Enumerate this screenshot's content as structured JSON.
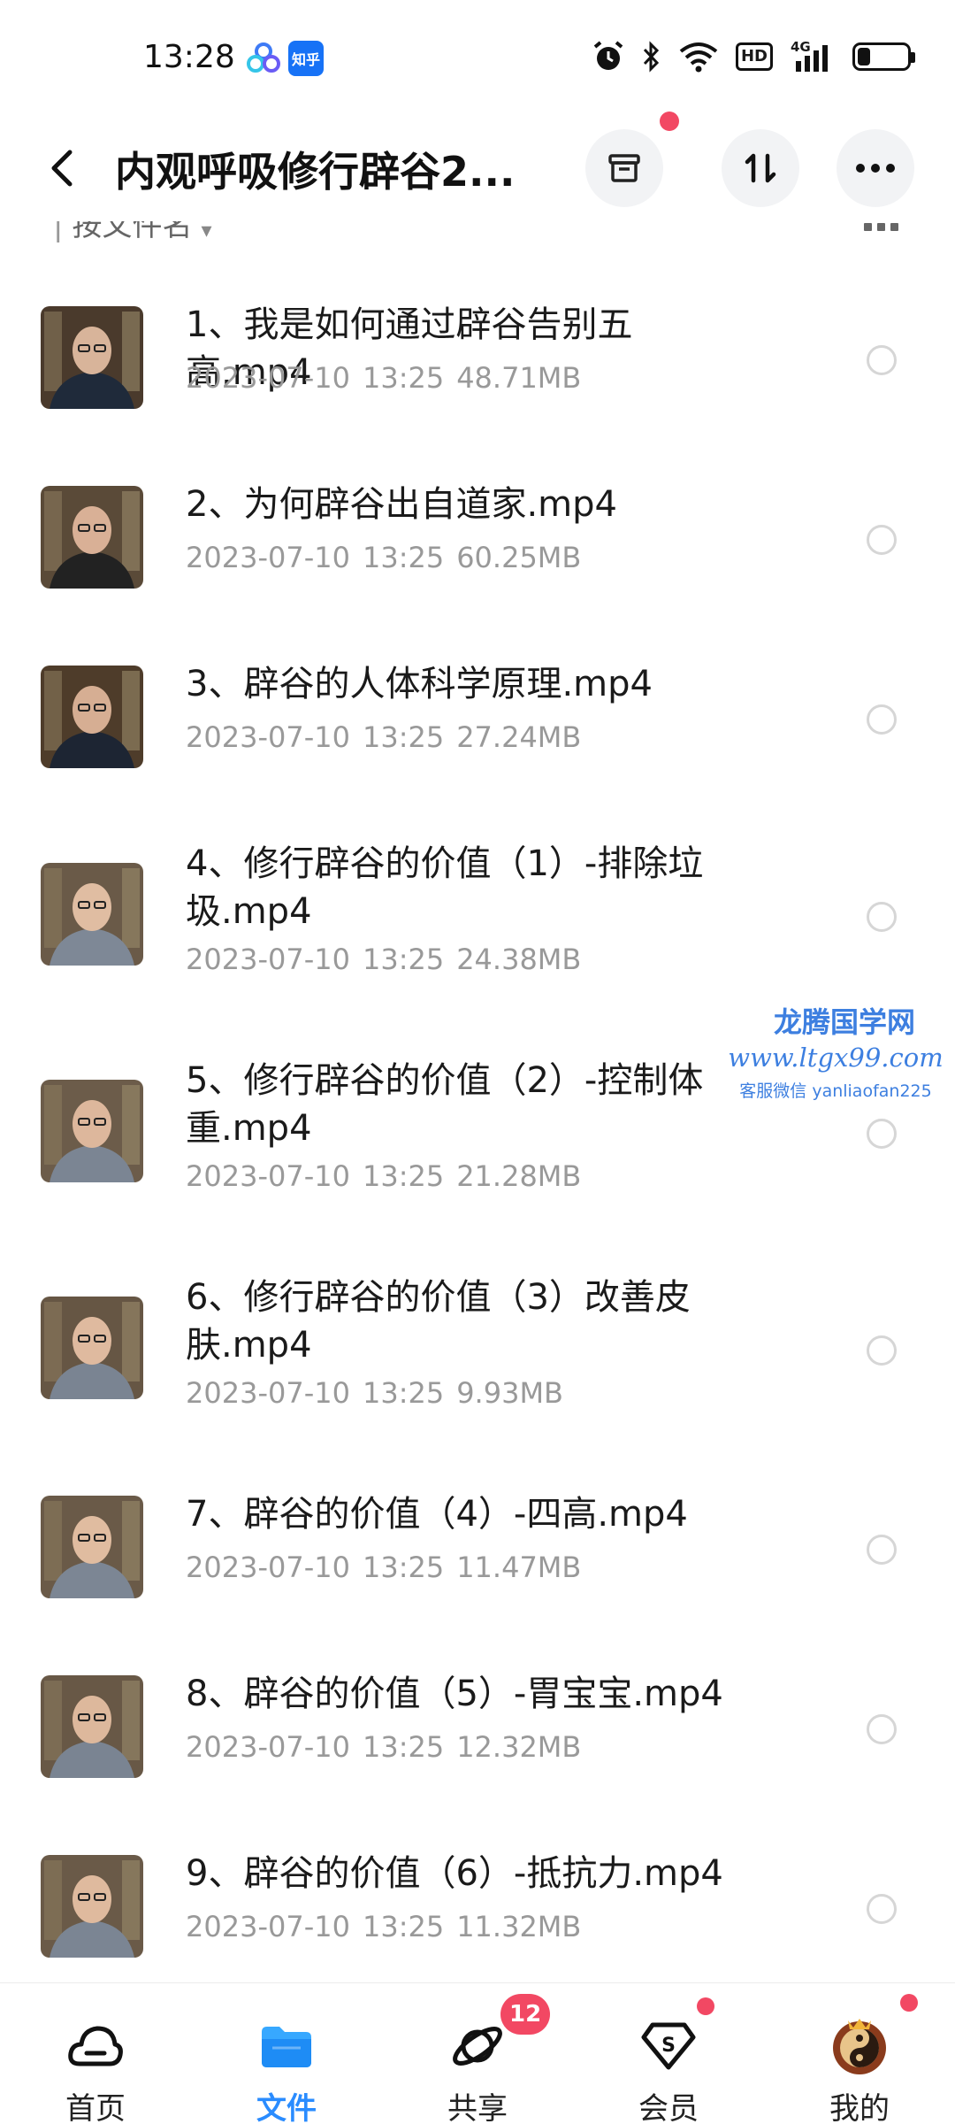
{
  "status_bar": {
    "time": "13:28",
    "app_icons": [
      "baidu-netdisk-icon",
      "zhihu-icon"
    ],
    "zhihu_label": "知乎",
    "right_icons": [
      "alarm-icon",
      "bluetooth-icon",
      "wifi-icon",
      "hd-icon",
      "4g-signal-icon",
      "battery-icon"
    ],
    "hd_label": "HD",
    "network_label": "4G",
    "battery_level": 0.25
  },
  "header": {
    "back_icon": "chevron-left-icon",
    "title": "内观呼吸修行辟谷2...",
    "archive_icon": "archive-icon",
    "sort_icon": "sort-arrows-icon",
    "more_icon": "more-horizontal-icon"
  },
  "sort_bar": {
    "label": "按文件名",
    "caret_icon": "caret-down-icon",
    "view_icon": "grid-view-icon"
  },
  "files": [
    {
      "name": "1、我是如何通过辟谷告别五高.mp4",
      "date": "2023-07-10",
      "time": "13:25",
      "size": "48.71MB"
    },
    {
      "name": "2、为何辟谷出自道家.mp4",
      "date": "2023-07-10",
      "time": "13:25",
      "size": "60.25MB"
    },
    {
      "name": "3、辟谷的人体科学原理.mp4",
      "date": "2023-07-10",
      "time": "13:25",
      "size": "27.24MB"
    },
    {
      "name": "4、修行辟谷的价值（1）-排除垃圾.mp4",
      "date": "2023-07-10",
      "time": "13:25",
      "size": "24.38MB"
    },
    {
      "name": "5、修行辟谷的价值（2）-控制体重.mp4",
      "date": "2023-07-10",
      "time": "13:25",
      "size": "21.28MB"
    },
    {
      "name": "6、修行辟谷的价值（3）改善皮肤.mp4",
      "date": "2023-07-10",
      "time": "13:25",
      "size": "9.93MB"
    },
    {
      "name": "7、辟谷的价值（4）-四高.mp4",
      "date": "2023-07-10",
      "time": "13:25",
      "size": "11.47MB"
    },
    {
      "name": "8、辟谷的价值（5）-胃宝宝.mp4",
      "date": "2023-07-10",
      "time": "13:25",
      "size": "12.32MB"
    },
    {
      "name": "9、辟谷的价值（6）-抵抗力.mp4",
      "date": "2023-07-10",
      "time": "13:25",
      "size": "11.32MB"
    }
  ],
  "watermark": {
    "line1": "龙腾国学网",
    "line2": "www.ltgx99.com",
    "line3": "客服微信 yanliaofan225"
  },
  "bottom_nav": {
    "items": [
      {
        "label": "首页",
        "icon": "home-cloud-icon"
      },
      {
        "label": "文件",
        "icon": "folder-icon"
      },
      {
        "label": "共享",
        "icon": "share-orbit-icon",
        "badge": "12"
      },
      {
        "label": "会员",
        "icon": "vip-diamond-icon"
      },
      {
        "label": "我的",
        "icon": "avatar-icon"
      }
    ]
  },
  "colors": {
    "accent": "#2a8cff",
    "badge": "#f24863",
    "meta_text": "#999999",
    "watermark": "#3d7fe0"
  }
}
